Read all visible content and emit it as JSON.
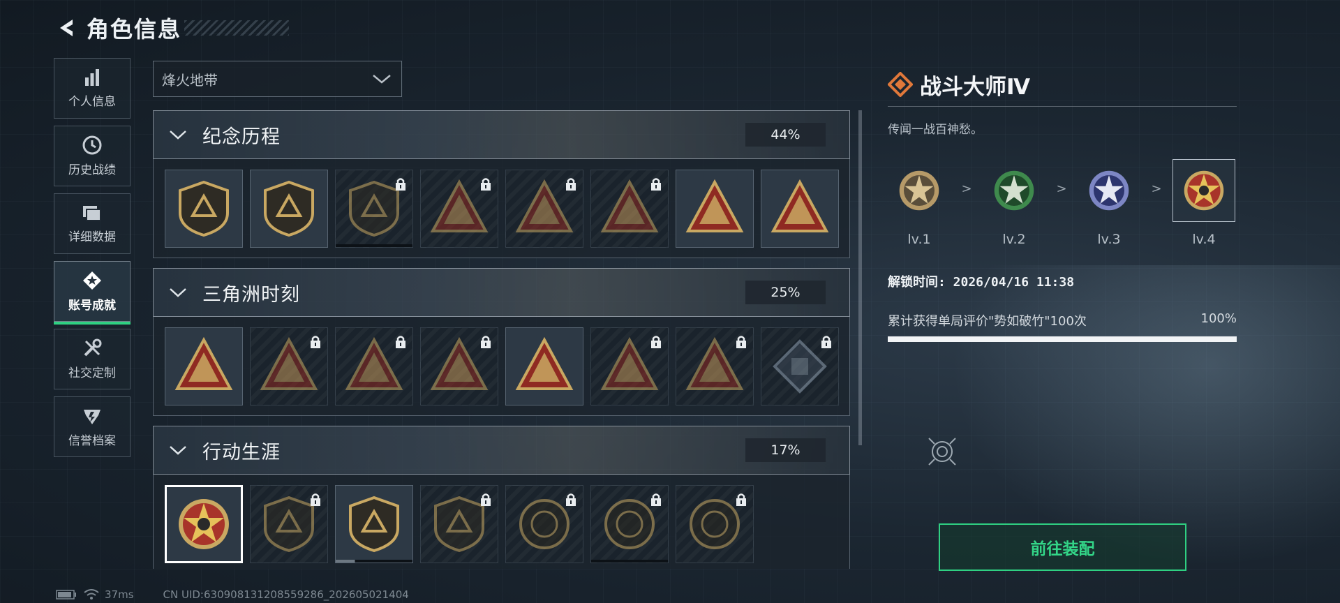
{
  "header": {
    "title": "角色信息"
  },
  "sidebar": {
    "items": [
      {
        "label": "个人信息",
        "icon": "bar-chart-icon",
        "active": false
      },
      {
        "label": "历史战绩",
        "icon": "clock-icon",
        "active": false
      },
      {
        "label": "详细数据",
        "icon": "folder-icon",
        "active": false
      },
      {
        "label": "账号成就",
        "icon": "achievement-icon",
        "active": true
      },
      {
        "label": "社交定制",
        "icon": "tools-icon",
        "active": false
      },
      {
        "label": "信誉档案",
        "icon": "reputation-icon",
        "active": false
      }
    ]
  },
  "mode_select": {
    "value": "烽火地带"
  },
  "sections": [
    {
      "title": "纪念历程",
      "percent": "44%",
      "badges": [
        "unlocked",
        "unlocked",
        "locked",
        "locked",
        "locked",
        "locked",
        "unlocked",
        "unlocked"
      ]
    },
    {
      "title": "三角洲时刻",
      "percent": "25%",
      "badges": [
        "unlocked",
        "locked",
        "locked",
        "locked",
        "unlocked",
        "locked",
        "locked",
        "locked"
      ]
    },
    {
      "title": "行动生涯",
      "percent": "17%",
      "badges": [
        "selected",
        "locked",
        "unlocked",
        "locked",
        "locked",
        "locked",
        "locked"
      ]
    }
  ],
  "detail": {
    "title": "战斗大师Ⅳ",
    "description": "传闻一战百神愁。",
    "levels": [
      "lv.1",
      "lv.2",
      "lv.3",
      "lv.4"
    ],
    "arrow": ">",
    "unlock_time": "解锁时间: 2026/04/16 11:38",
    "condition": {
      "text": "累计获得单局评价\"势如破竹\"100次",
      "percent": "100%",
      "progress": 1.0
    },
    "equip_button": "前往装配"
  },
  "status": {
    "ping": "37ms",
    "uid": "CN UID:630908131208559286_202605021404"
  },
  "colors": {
    "accent_green": "#2fd082",
    "badge_gold": "#c9a862",
    "badge_red": "#8f2a22"
  }
}
